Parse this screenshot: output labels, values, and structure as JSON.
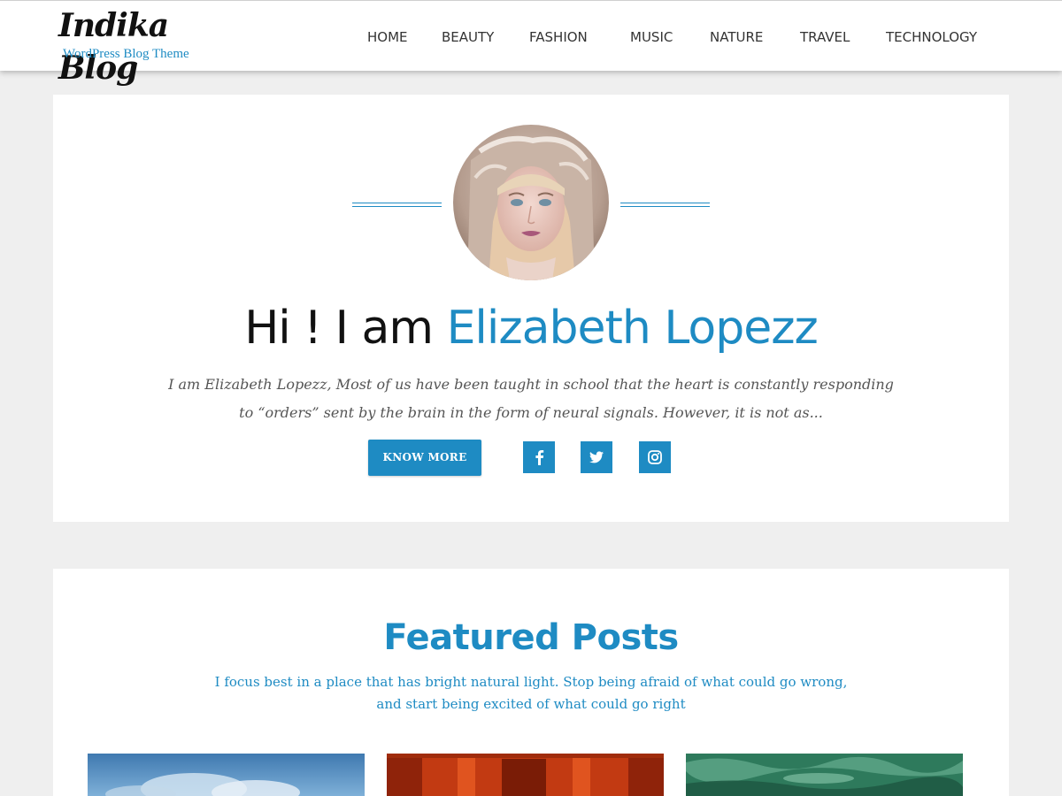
{
  "header": {
    "logo_title": "Indika Blog",
    "logo_tagline": "WordPress Blog Theme",
    "nav": [
      "HOME",
      "BEAUTY",
      "FASHION",
      "MUSIC",
      "NATURE",
      "TRAVEL",
      "TECHNOLOGY"
    ]
  },
  "intro": {
    "greeting": "Hi ! I am ",
    "name": "Elizabeth Lopezz",
    "text": "I am Elizabeth Lopezz, Most of us have been taught in school that the heart is constantly responding to “orders” sent by the brain in the form of neural signals. However, it is not as...",
    "button": "KNOW MORE",
    "social": [
      "facebook-icon",
      "twitter-icon",
      "instagram-icon"
    ]
  },
  "featured": {
    "title": "Featured Posts",
    "subtitle": "I focus best in a place that has bright natural light. Stop being afraid of what could go wrong, and start being excited of what could go right"
  },
  "colors": {
    "accent": "#1e8bc3",
    "page_bg": "#efefef",
    "card_bg": "#ffffff",
    "text_dark": "#111111",
    "text_muted": "#555555"
  }
}
